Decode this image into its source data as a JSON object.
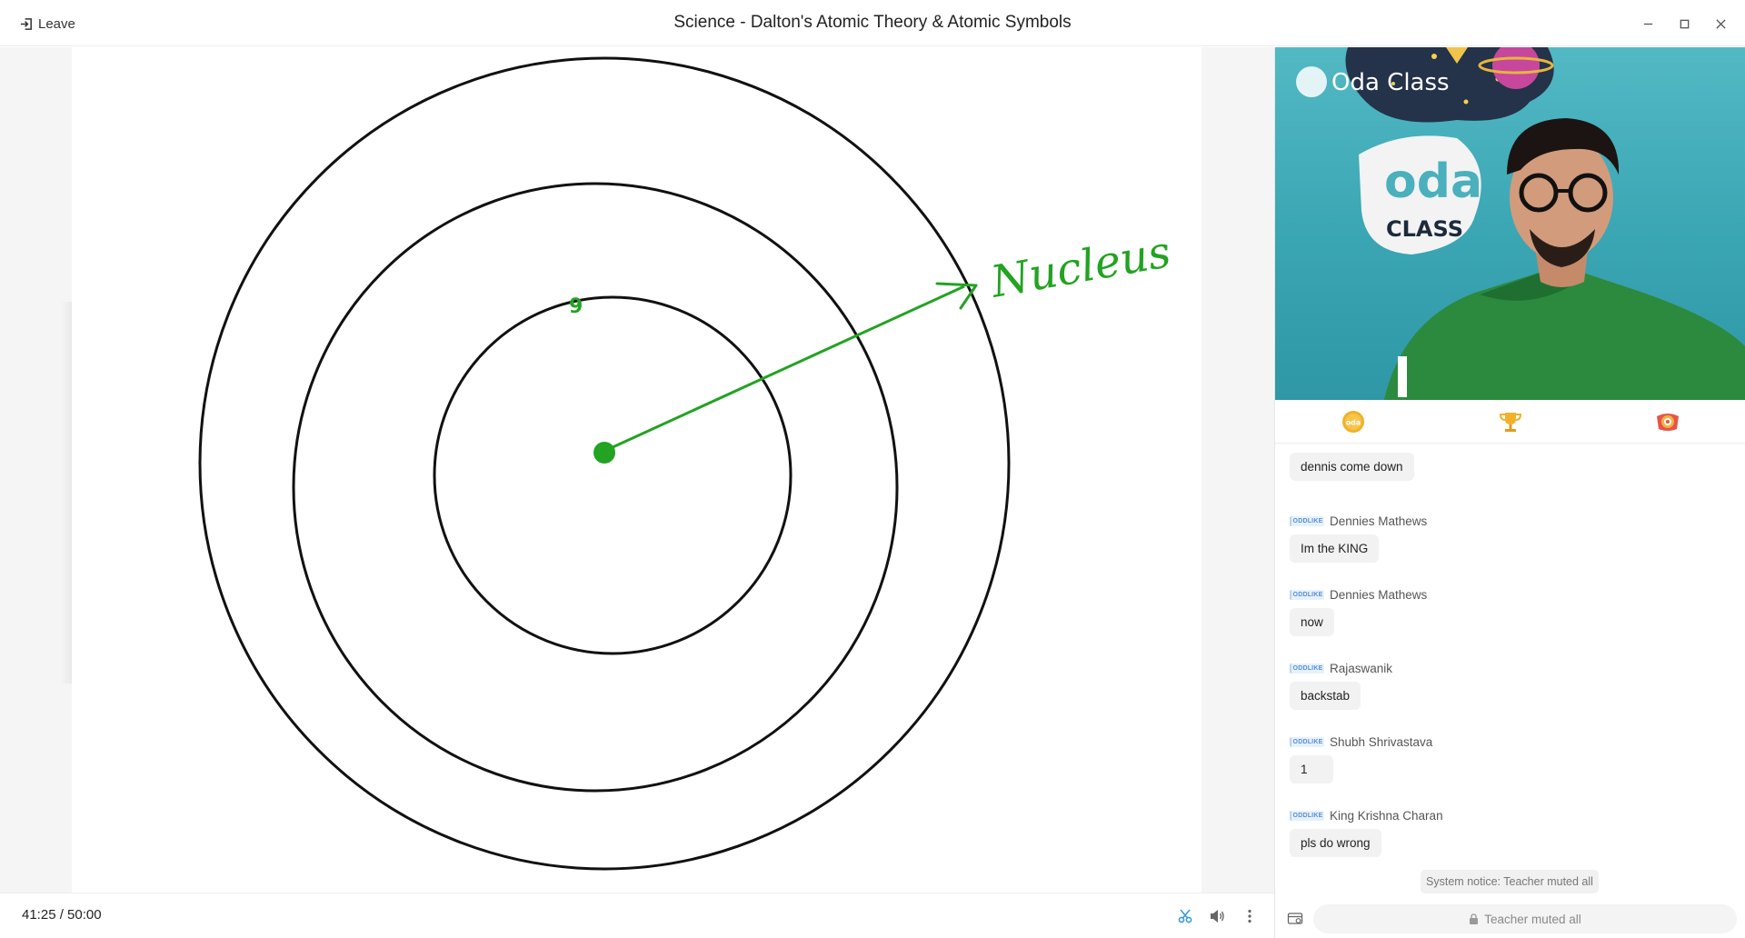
{
  "window": {
    "title": "Science - Dalton's Atomic Theory & Atomic Symbols",
    "leave_label": "Leave",
    "controls": [
      "minimize-icon",
      "maximize-icon",
      "close-icon"
    ]
  },
  "whiteboard": {
    "annotation_text": "Nucleus",
    "annotation_color": "#22a322",
    "small_mark_text": "9",
    "orbit_count": 3
  },
  "bottom_bar": {
    "timer": "41:25  / 50:00",
    "icons": [
      "scissors-icon",
      "volume-icon",
      "more-vertical-icon"
    ]
  },
  "video": {
    "logo_text": "Oda Class",
    "banner_text_top": "oda",
    "banner_text_bottom": "CLASS"
  },
  "tabs": [
    {
      "name": "coins-tab",
      "icon": "oda-coin-icon",
      "color": "#f2b12b"
    },
    {
      "name": "leaderboard-tab",
      "icon": "trophy-icon",
      "color": "#f2b12b"
    },
    {
      "name": "rewards-tab",
      "icon": "badge-icon",
      "color": "#e8534a"
    }
  ],
  "chat": {
    "badge_text": "ODDLIKE",
    "messages": [
      {
        "sender": "",
        "text": "dennis come down"
      },
      {
        "sender": "Dennies Mathews",
        "text": "Im the KING"
      },
      {
        "sender": "Dennies Mathews",
        "text": "now"
      },
      {
        "sender": "Rajaswanik",
        "text": "backstab"
      },
      {
        "sender": "Shubh Shrivastava",
        "text": "1"
      },
      {
        "sender": "King Krishna Charan",
        "text": "pls do wrong"
      }
    ],
    "system_notice": "System notice: Teacher muted all",
    "input_placeholder": "Teacher muted all"
  }
}
